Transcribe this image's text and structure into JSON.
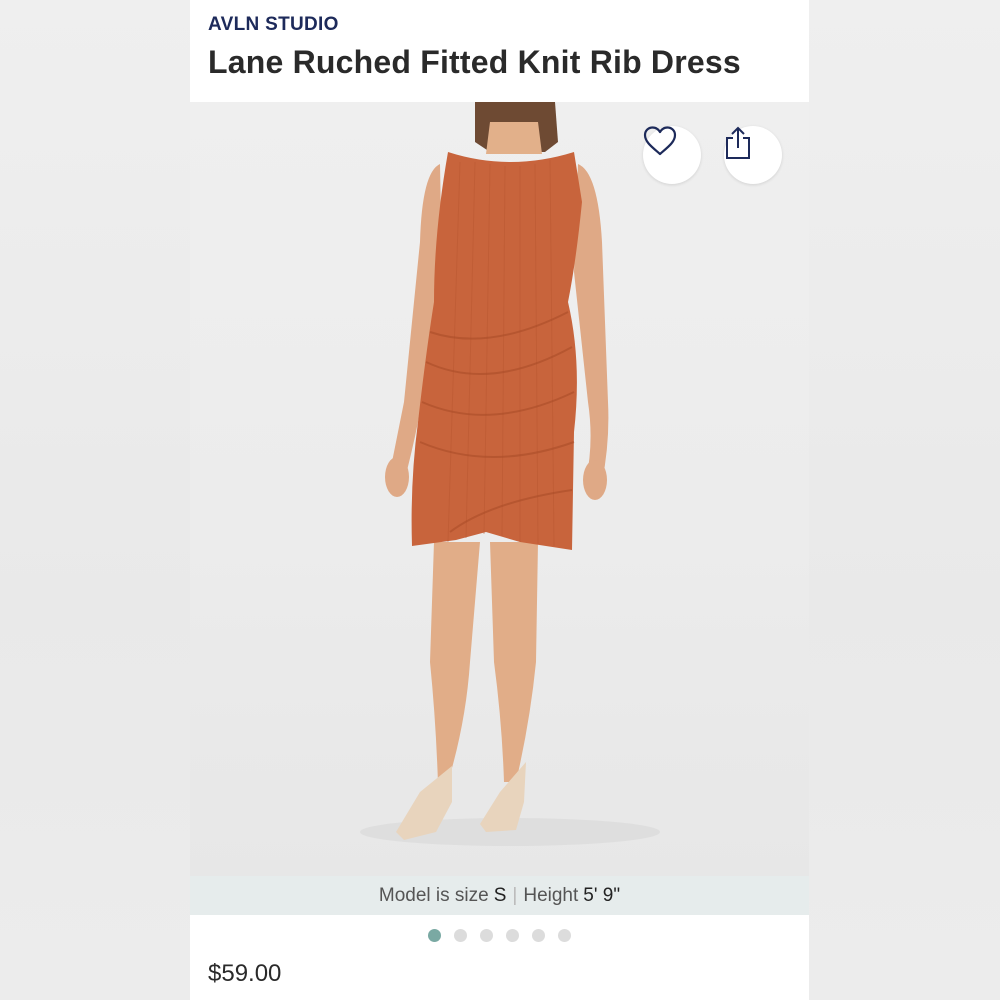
{
  "product": {
    "brand": "AVLN STUDIO",
    "title": "Lane Ruched Fitted Knit Rib Dress",
    "price": "$59.00",
    "dress_color": "#c8643c"
  },
  "actions": {
    "favorite_icon": "heart-icon",
    "share_icon": "share-icon"
  },
  "model_info": {
    "size_label": "Model is size",
    "size_value": "S",
    "separator": "|",
    "height_label": "Height",
    "height_value": "5' 9\""
  },
  "carousel": {
    "total": 6,
    "active_index": 0,
    "active_color": "#7aa9a3",
    "inactive_color": "#dcdcdc"
  }
}
